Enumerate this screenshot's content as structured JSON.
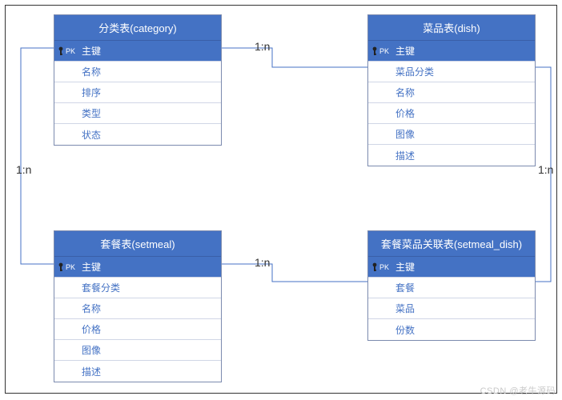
{
  "entities": {
    "category": {
      "title": "分类表(category)",
      "pk": "主键",
      "fields": [
        "名称",
        "排序",
        "类型",
        "状态"
      ]
    },
    "dish": {
      "title": "菜品表(dish)",
      "pk": "主键",
      "fields": [
        "菜品分类",
        "名称",
        "价格",
        "图像",
        "描述"
      ]
    },
    "setmeal": {
      "title": "套餐表(setmeal)",
      "pk": "主键",
      "fields": [
        "套餐分类",
        "名称",
        "价格",
        "图像",
        "描述"
      ]
    },
    "setmeal_dish": {
      "title": "套餐菜品关联表(setmeal_dish)",
      "pk": "主键",
      "fields": [
        "套餐",
        "菜品",
        "份数"
      ]
    }
  },
  "relations": {
    "r1": "1:n",
    "r2": "1:n",
    "r3": "1:n",
    "r4": "1:n"
  },
  "pk_label": "PK",
  "watermark": "CSDN @老牛源码"
}
